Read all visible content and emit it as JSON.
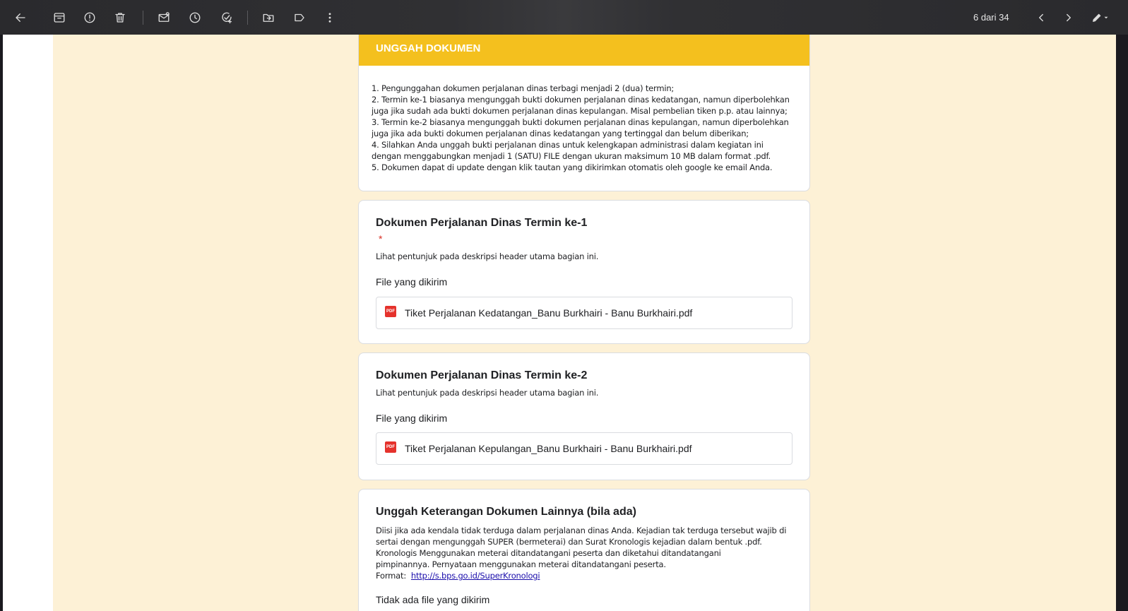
{
  "toolbar": {
    "pager": "6 dari 34"
  },
  "header": {
    "title": "UNGGAH DOKUMEN",
    "description": "1. Pengunggahan dokumen perjalanan dinas terbagi menjadi 2 (dua) termin;\n2. Termin ke-1 biasanya mengunggah bukti dokumen perjalanan dinas kedatangan, namun diperbolehkan\njuga jika sudah ada bukti dokumen perjalanan dinas kepulangan. Misal pembelian tiken p.p. atau lainnya;\n3. Termin ke-2 biasanya mengunggah bukti dokumen perjalanan dinas kepulangan, namun diperbolehkan\njuga jika ada bukti dokumen perjalanan dinas kedatangan yang tertinggal dan belum diberikan;\n4. Silahkan Anda unggah bukti perjalanan dinas untuk kelengkapan administrasi dalam kegiatan ini\ndengan menggabungkan menjadi 1 (SATU) FILE dengan ukuran maksimum 10 MB dalam format .pdf.\n5. Dokumen dapat di update dengan klik tautan yang dikirimkan  otomatis oleh google ke email Anda."
  },
  "q1": {
    "title": "Dokumen Perjalanan Dinas Termin ke-1",
    "required_mark": "*",
    "description": "Lihat pentunjuk pada deskripsi header utama bagian ini.",
    "file_label": "File yang dikirim",
    "file_icon": "PDF",
    "file_name": "Tiket Perjalanan Kedatangan_Banu Burkhairi - Banu Burkhairi.pdf"
  },
  "q2": {
    "title": "Dokumen Perjalanan Dinas Termin ke-2",
    "description": "Lihat pentunjuk pada deskripsi header utama bagian ini.",
    "file_label": "File yang dikirim",
    "file_icon": "PDF",
    "file_name": "Tiket Perjalanan Kepulangan_Banu Burkhairi - Banu Burkhairi.pdf"
  },
  "q3": {
    "title": "Unggah Keterangan Dokumen Lainnya (bila ada)",
    "description_lines": [
      "Diisi jika ada kendala tidak terduga dalam perjalanan dinas Anda. Kejadian tak terduga tersebut wajib di",
      "sertai dengan mengunggah SUPER (bermeterai) dan Surat Kronologis kejadian dalam bentuk  .pdf.",
      "Kronologis Menggunakan meterai ditandatangani peserta dan diketahui ditandatangani",
      "pimpinannya. Pernyataan menggunakan meterai ditandatangani peserta."
    ],
    "format_label": "Format:",
    "format_link": "http://s.bps.go.id/SuperKronologi",
    "no_file": "Tidak ada file yang dikirim"
  },
  "colors": {
    "accent": "#f4c01e",
    "cream": "#fdf1d6",
    "pdf_red": "#e5322c"
  }
}
